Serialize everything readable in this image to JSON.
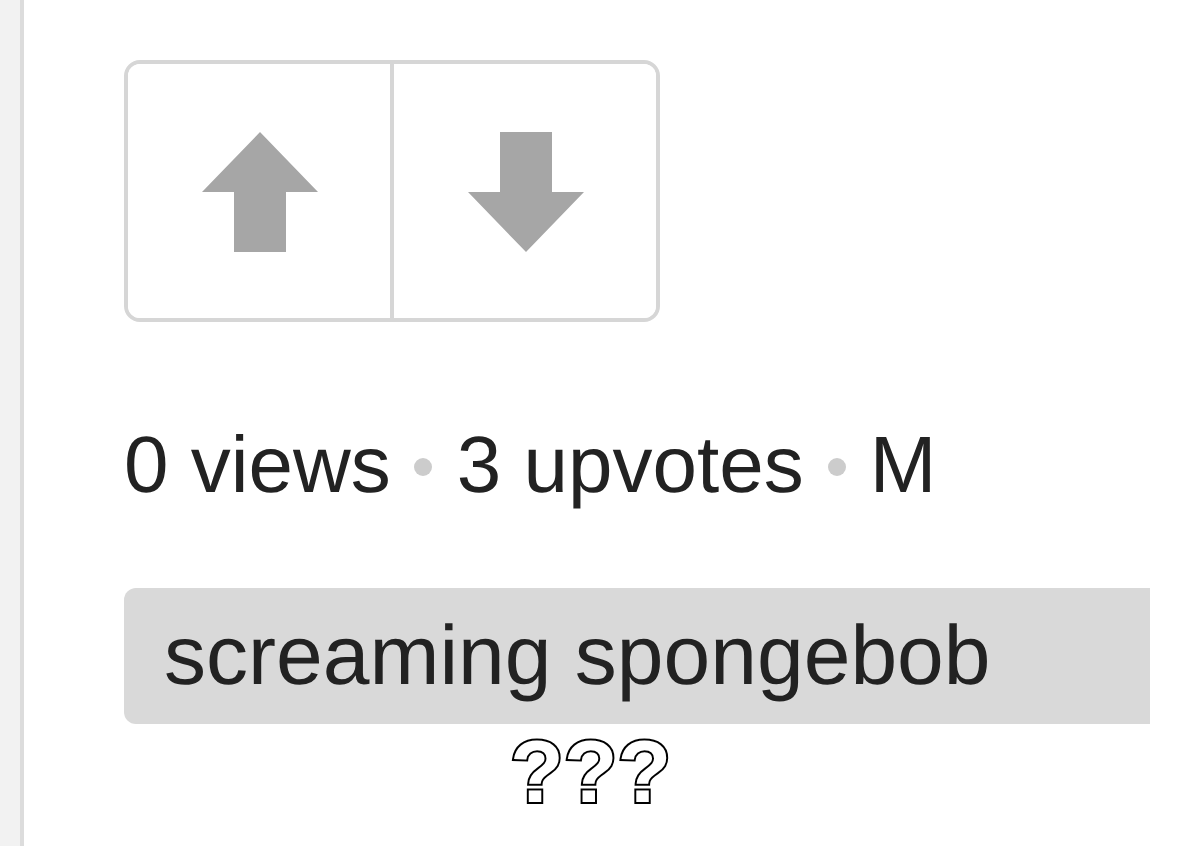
{
  "vote_buttons": [
    {
      "kind": "up"
    },
    {
      "kind": "down"
    }
  ],
  "stats": [
    "0 views",
    "3 upvotes",
    "M"
  ],
  "tags": [
    "screaming spongebob"
  ],
  "caption": "???"
}
